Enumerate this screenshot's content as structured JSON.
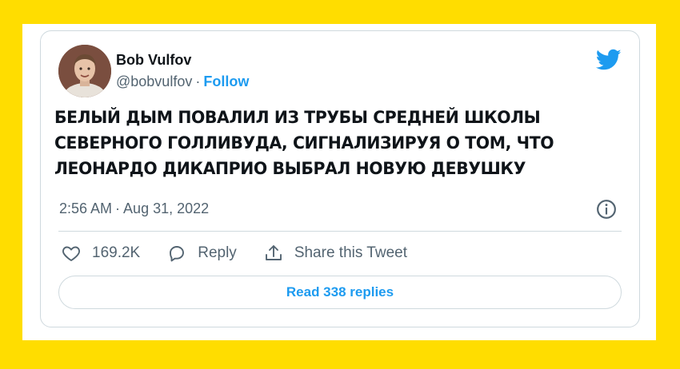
{
  "author": {
    "name": "Bob Vulfov",
    "handle": "@bobvulfov",
    "separator": "·",
    "follow_label": "Follow"
  },
  "tweet": {
    "lines": [
      "БЕЛЫЙ ДЫМ ПОВАЛИЛ ИЗ ТРУБЫ СРЕДНЕЙ ШКОЛЫ",
      "СЕВЕРНОГО ГОЛЛИВУДА, СИГНАЛИЗИРУЯ О ТОМ, ЧТО",
      "ЛЕОНАРДО ДИКАПРИО ВЫБРАЛ НОВУЮ ДЕВУШКУ"
    ],
    "time": "2:56 AM",
    "date": "Aug 31, 2022"
  },
  "actions": {
    "like_count": "169.2K",
    "reply_label": "Reply",
    "share_label": "Share this Tweet"
  },
  "read_replies_label": "Read 338 replies",
  "icons": {
    "brand": "twitter-bird-icon",
    "info": "info-icon",
    "like": "heart-icon",
    "reply": "speech-bubble-icon",
    "share": "share-icon"
  },
  "colors": {
    "background": "#FFDD00",
    "accent": "#1d9bf0",
    "text": "#0f1419",
    "muted": "#536471",
    "border": "#cfd9de"
  }
}
